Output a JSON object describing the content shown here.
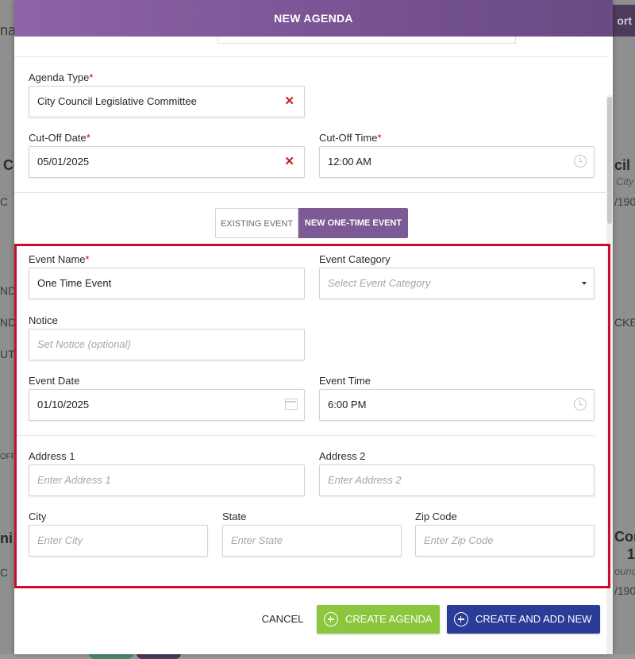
{
  "background": {
    "left_fragments": [
      "na",
      "Co",
      "C",
      "ND",
      "ND",
      "UTI",
      "OFF",
      "ni",
      "C"
    ],
    "right_fragments": [
      "ort",
      "cil R",
      "City",
      "/190",
      "CKE",
      "Cor",
      "1",
      "ounc",
      "/190"
    ]
  },
  "modal": {
    "title": "NEW AGENDA",
    "agenda_type": {
      "label": "Agenda Type",
      "required_mark": "*",
      "value": "City Council Legislative Committee"
    },
    "cutoff_date": {
      "label": "Cut-Off Date",
      "required_mark": "*",
      "value": "05/01/2025"
    },
    "cutoff_time": {
      "label": "Cut-Off Time",
      "required_mark": "*",
      "value": "12:00 AM"
    },
    "event_toggle": {
      "existing": "EXISTING EVENT",
      "new_one_time": "NEW ONE-TIME EVENT",
      "selected": "new_one_time"
    },
    "event_name": {
      "label": "Event Name",
      "required_mark": "*",
      "value": "One Time Event"
    },
    "event_category": {
      "label": "Event Category",
      "placeholder": "Select Event Category"
    },
    "notice": {
      "label": "Notice",
      "placeholder": "Set Notice (optional)"
    },
    "event_date": {
      "label": "Event Date",
      "value": "01/10/2025"
    },
    "event_time": {
      "label": "Event Time",
      "value": "6:00 PM"
    },
    "address1": {
      "label": "Address 1",
      "placeholder": "Enter Address 1"
    },
    "address2": {
      "label": "Address 2",
      "placeholder": "Enter Address 2"
    },
    "city": {
      "label": "City",
      "placeholder": "Enter City"
    },
    "state": {
      "label": "State",
      "placeholder": "Enter State"
    },
    "zip": {
      "label": "Zip Code",
      "placeholder": "Enter Zip Code"
    },
    "footer": {
      "cancel": "CANCEL",
      "create_agenda": "CREATE AGENDA",
      "create_add_new": "CREATE AND ADD NEW"
    }
  },
  "colors": {
    "header": "#7a5595",
    "accent_required": "#d0021b",
    "highlight_border": "#c8102e",
    "create_agenda": "#8cc63f",
    "create_add_new": "#2b3b98"
  }
}
